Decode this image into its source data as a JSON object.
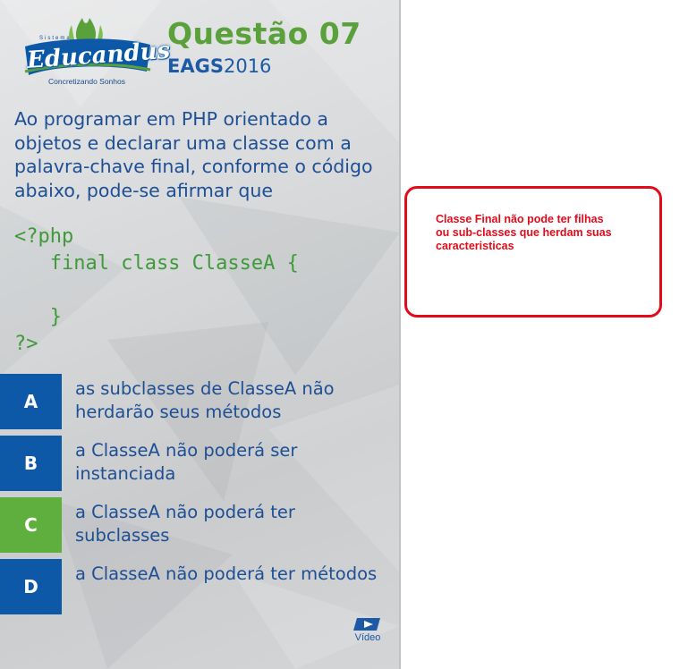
{
  "slide": {
    "logo": {
      "small_text": "Sistema",
      "brand": "Educandus",
      "tagline": "Concretizando Sonhos"
    },
    "title": "Questão 07",
    "exam_name": "EAGS",
    "exam_year": "2016",
    "question_text": "Ao programar em PHP orientado a objetos e declarar uma classe com a palavra-chave final, conforme o código abaixo, pode-se afirmar que",
    "code": {
      "line1": "<?php",
      "line2": "   final class ClasseA {",
      "line3": "",
      "line4": "   }",
      "line5": "?>"
    },
    "options": [
      {
        "letter": "A",
        "text": "as subclasses de ClasseA não herdarão seus métodos",
        "color": "#0d59a8"
      },
      {
        "letter": "B",
        "text": "a ClasseA não poderá ser instanciada",
        "color": "#0d59a8"
      },
      {
        "letter": "C",
        "text": "a ClasseA não poderá ter subclasses",
        "color": "#5faf3e"
      },
      {
        "letter": "D",
        "text": "a ClasseA não poderá ter métodos",
        "color": "#0d59a8"
      }
    ],
    "video_label": "Vídeo"
  },
  "annotation": {
    "text": "Classe Final não pode ter filhas ou sub-classes que herdam suas caracteristicas",
    "border_color": "#e30b1a"
  }
}
